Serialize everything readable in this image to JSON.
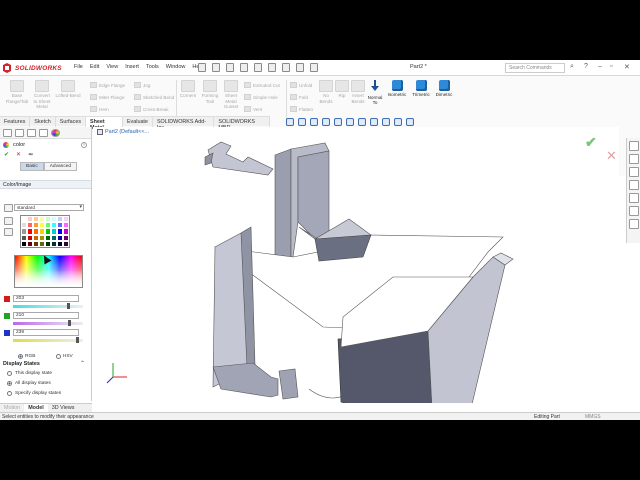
{
  "app": {
    "brand": "SOLIDWORKS",
    "document_title": "Part2 *"
  },
  "menu": [
    "File",
    "Edit",
    "View",
    "Insert",
    "Tools",
    "Window",
    "Help"
  ],
  "search": {
    "placeholder": "Search Commands"
  },
  "command_manager": {
    "large": [
      {
        "label1": "Base",
        "label2": "Flange/Tab"
      },
      {
        "label1": "Convert",
        "label2": "to Sheet",
        "label3": "Metal"
      },
      {
        "label1": "Lofted-Bend",
        "label2": ""
      },
      {
        "label1": "Corners",
        "label2": ""
      },
      {
        "label1": "Forming",
        "label2": "Tool"
      },
      {
        "label1": "Sheet",
        "label2": "Metal",
        "label3": "Gusset"
      },
      {
        "label1": "No",
        "label2": "Bends"
      },
      {
        "label1": "Rip",
        "label2": ""
      },
      {
        "label1": "Insert",
        "label2": "Bends"
      },
      {
        "label1": "Normal",
        "label2": "To"
      },
      {
        "label1": "Isometric",
        "label2": ""
      },
      {
        "label1": "Trimetric",
        "label2": ""
      },
      {
        "label1": "Dimetric",
        "label2": ""
      }
    ],
    "small": {
      "edge_flange": "Edge Flange",
      "miter_flange": "Miter Flange",
      "hem": "Hem",
      "jog": "Jog",
      "sketched_bend": "Sketched Bend",
      "cross_break": "Cross-Break",
      "extruded_cut": "Extruded Cut",
      "simple_hole": "Simple Hole",
      "vent": "Vent",
      "unfold": "Unfold",
      "fold": "Fold",
      "flatten": "Flatten"
    }
  },
  "tabs": [
    "Features",
    "Sketch",
    "Surfaces",
    "Sheet Metal",
    "Evaluate",
    "SOLIDWORKS Add-Ins",
    "SOLIDWORKS MBD"
  ],
  "active_tab": "Sheet Metal",
  "tree_node": "Part2 (Default<<...",
  "panel": {
    "title": "color",
    "mode_basic": "Basic",
    "mode_advanced": "Advanced",
    "section_color": "Color/Image",
    "palette_dropdown": "standard",
    "rgb": {
      "r": "203",
      "g": "210",
      "b": "239"
    },
    "rgb_fill": {
      "r": 0.8,
      "g": 0.82,
      "b": 0.94
    },
    "radio_rgb": "RGB",
    "radio_hsv": "HSV",
    "display_states_title": "Display States",
    "ds_this": "This display state",
    "ds_all": "All display states",
    "ds_specify": "Specify display states"
  },
  "bottom_tabs": [
    "Model",
    "3D Views"
  ],
  "bottom_tab_prefix": "Motion",
  "status": {
    "left": "Select entities to modify their appearance",
    "mid": "Editing Part",
    "units": "MMGS"
  },
  "colors": {
    "brand": "#d2232a",
    "accent": "#2e8ad8",
    "part_face": "#a9adbd"
  }
}
